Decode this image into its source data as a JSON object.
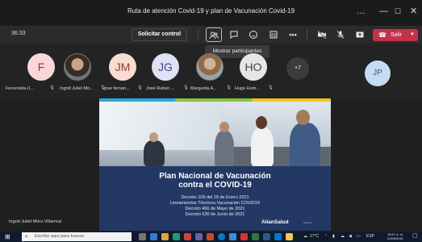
{
  "window": {
    "title": "Ruta de atención Covid-19 y plan de Vacunación Covid-19",
    "controls": [
      "…",
      "—",
      "☐",
      "✕"
    ]
  },
  "toolbar": {
    "timer": "36:33",
    "request_control_label": "Solicitar control",
    "leave_label": "Salir",
    "tooltip": "Mostrar participantes"
  },
  "participants": [
    {
      "initials": "F",
      "name": "Feconvida (I...",
      "bg": "#f8d7d6",
      "fg": "#8a3a3a"
    },
    {
      "initials": "",
      "name": "Ingrid Juliet Mo...",
      "photo": true
    },
    {
      "initials": "JM",
      "name": "jose fernan...",
      "bg": "#f9dcd2",
      "fg": "#8a3f2e"
    },
    {
      "initials": "JG",
      "name": "José Ruben ...",
      "bg": "#dfe1f4",
      "fg": "#3b4780"
    },
    {
      "initials": "",
      "name": "Margarita A...",
      "photo": true
    },
    {
      "initials": "HO",
      "name": "Hugo Hum...",
      "bg": "#e6e6e6",
      "fg": "#444"
    }
  ],
  "more_count": "+7",
  "self_initials": "JP",
  "presenter_name": "Ingrid Juliet Mora Villarreal",
  "slide": {
    "title_line1": "Plan Nacional de Vacunación",
    "title_line2": "contra el COVID-19",
    "lines": [
      "Decreto 109 del 29 de Enero 2021",
      "Lineamientos Técnicos Vacunación COVID19",
      "Decreto 466 de Mayo de 2021",
      "Decreto 630 de Junio de 2021"
    ],
    "logo": "AlianSalud"
  },
  "taskbar": {
    "search_placeholder": "Escribe aquí para buscar",
    "weather": "17°C",
    "lang": "ESP",
    "time": "10:27 a. m.",
    "date": "21/09/2021"
  },
  "colors": {
    "leave": "#c4314b",
    "self_avatar": "#c7dbf3"
  }
}
